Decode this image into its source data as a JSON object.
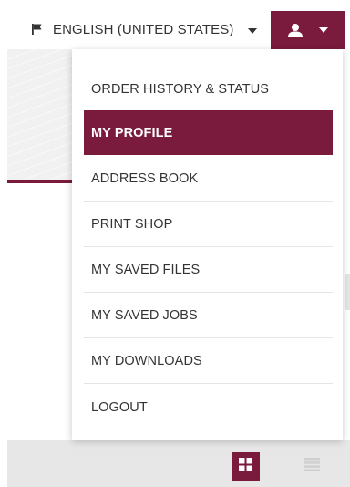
{
  "header": {
    "language_label": "ENGLISH (UNITED STATES)",
    "language_icon": "flag-icon",
    "user_icon": "user-icon"
  },
  "menu": {
    "items": [
      {
        "label": "ORDER HISTORY & STATUS",
        "active": false
      },
      {
        "label": "MY PROFILE",
        "active": true
      },
      {
        "label": "ADDRESS BOOK",
        "active": false
      },
      {
        "label": "PRINT SHOP",
        "active": false
      },
      {
        "label": "MY SAVED FILES",
        "active": false
      },
      {
        "label": "MY SAVED JOBS",
        "active": false
      },
      {
        "label": "MY DOWNLOADS",
        "active": false
      },
      {
        "label": "LOGOUT",
        "active": false
      }
    ]
  },
  "view_toggle": {
    "grid_icon": "grid-view-icon",
    "list_icon": "list-view-icon",
    "selected": "grid"
  },
  "colors": {
    "accent": "#7a1a3c",
    "text": "#333333",
    "bottom_bar": "#e7e7e7"
  }
}
